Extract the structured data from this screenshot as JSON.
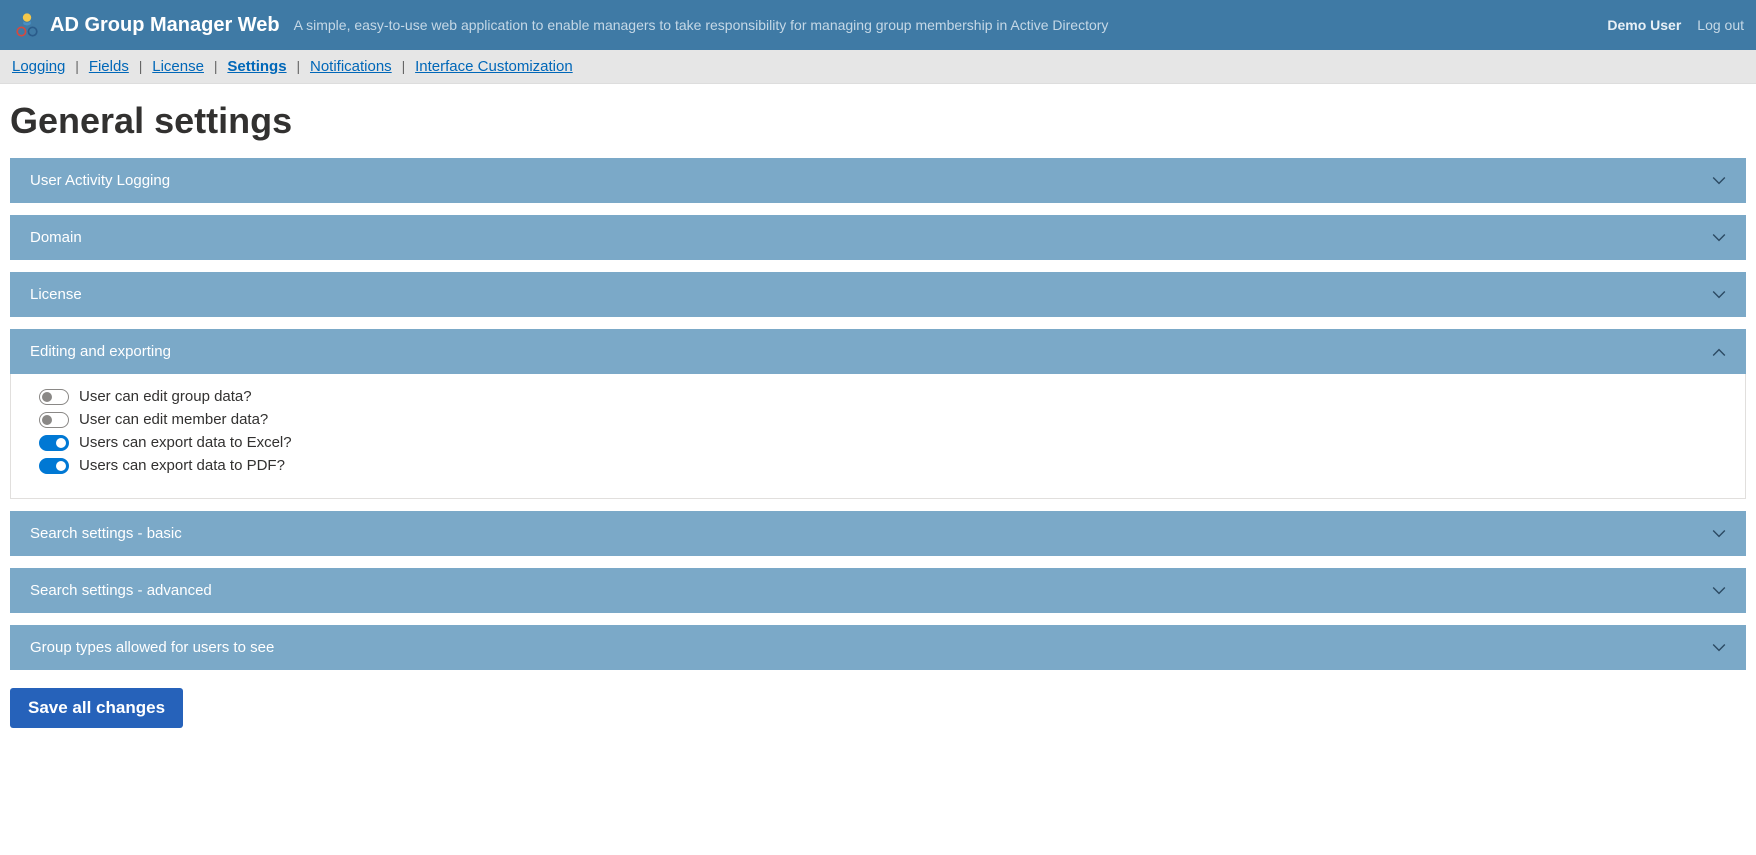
{
  "header": {
    "app_title": "AD Group Manager Web",
    "tagline": "A simple, easy-to-use web application to enable managers to take responsibility for managing group membership in Active Directory",
    "user": "Demo User",
    "logout": "Log out"
  },
  "nav": {
    "items": [
      {
        "label": "Logging",
        "active": false
      },
      {
        "label": "Fields",
        "active": false
      },
      {
        "label": "License",
        "active": false
      },
      {
        "label": "Settings",
        "active": true
      },
      {
        "label": "Notifications",
        "active": false
      },
      {
        "label": "Interface Customization",
        "active": false
      }
    ]
  },
  "page": {
    "title": "General settings"
  },
  "panels": [
    {
      "title": "User Activity Logging",
      "expanded": false
    },
    {
      "title": "Domain",
      "expanded": false
    },
    {
      "title": "License",
      "expanded": false
    },
    {
      "title": "Editing and exporting",
      "expanded": true,
      "options": [
        {
          "label": "User can edit group data?",
          "value": false
        },
        {
          "label": "User can edit member data?",
          "value": false
        },
        {
          "label": "Users can export data to Excel?",
          "value": true
        },
        {
          "label": "Users can export data to PDF?",
          "value": true
        }
      ]
    },
    {
      "title": "Search settings - basic",
      "expanded": false
    },
    {
      "title": "Search settings - advanced",
      "expanded": false
    },
    {
      "title": "Group types allowed for users to see",
      "expanded": false
    }
  ],
  "actions": {
    "save": "Save all changes"
  }
}
